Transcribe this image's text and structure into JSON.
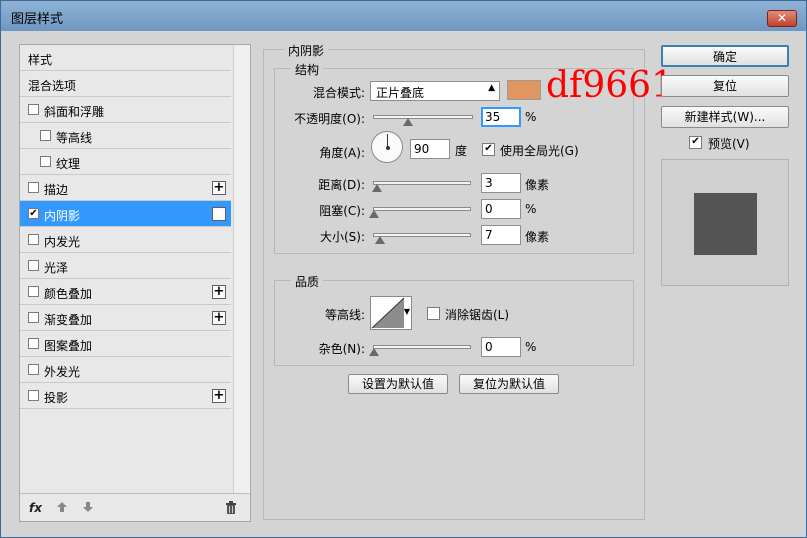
{
  "window": {
    "title": "图层样式",
    "close_label": "✕"
  },
  "style_list": {
    "items": [
      {
        "label": "样式",
        "checkbox": false,
        "plus": false,
        "indent": 0,
        "checked": false,
        "selected": false
      },
      {
        "label": "混合选项",
        "checkbox": false,
        "plus": false,
        "indent": 0,
        "checked": false,
        "selected": false
      },
      {
        "label": "斜面和浮雕",
        "checkbox": true,
        "plus": false,
        "indent": 0,
        "checked": false,
        "selected": false
      },
      {
        "label": "等高线",
        "checkbox": true,
        "plus": false,
        "indent": 1,
        "checked": false,
        "selected": false
      },
      {
        "label": "纹理",
        "checkbox": true,
        "plus": false,
        "indent": 1,
        "checked": false,
        "selected": false
      },
      {
        "label": "描边",
        "checkbox": true,
        "plus": true,
        "indent": 0,
        "checked": false,
        "selected": false
      },
      {
        "label": "内阴影",
        "checkbox": true,
        "plus": true,
        "indent": 0,
        "checked": true,
        "selected": true
      },
      {
        "label": "内发光",
        "checkbox": true,
        "plus": false,
        "indent": 0,
        "checked": false,
        "selected": false
      },
      {
        "label": "光泽",
        "checkbox": true,
        "plus": false,
        "indent": 0,
        "checked": false,
        "selected": false
      },
      {
        "label": "颜色叠加",
        "checkbox": true,
        "plus": true,
        "indent": 0,
        "checked": false,
        "selected": false
      },
      {
        "label": "渐变叠加",
        "checkbox": true,
        "plus": true,
        "indent": 0,
        "checked": false,
        "selected": false
      },
      {
        "label": "图案叠加",
        "checkbox": true,
        "plus": false,
        "indent": 0,
        "checked": false,
        "selected": false
      },
      {
        "label": "外发光",
        "checkbox": true,
        "plus": false,
        "indent": 0,
        "checked": false,
        "selected": false
      },
      {
        "label": "投影",
        "checkbox": true,
        "plus": true,
        "indent": 0,
        "checked": false,
        "selected": false
      }
    ],
    "footer": {
      "fx_label": "fx",
      "up_icon": "arrow-up-icon",
      "down_icon": "arrow-down-icon",
      "trash_icon": "trash-icon"
    }
  },
  "inner_shadow": {
    "title": "内阴影",
    "structure": {
      "title": "结构",
      "blend_mode_label": "混合模式:",
      "blend_mode_value": "正片叠底",
      "color_swatch": "#df9661",
      "annotation": "df9661",
      "opacity_label": "不透明度(O):",
      "opacity_value": "35",
      "opacity_level": 0.35,
      "percent": "%",
      "angle_label": "角度(A):",
      "angle_value": "90",
      "angle_unit": "度",
      "global_light_label": "使用全局光(G)",
      "global_light_checked": true,
      "distance_label": "距离(D):",
      "distance_value": "3",
      "pixels": "像素",
      "choke_label": "阻塞(C):",
      "choke_value": "0",
      "size_label": "大小(S):",
      "size_value": "7"
    },
    "quality": {
      "title": "品质",
      "contour_label": "等高线:",
      "antialias_label": "消除锯齿(L)",
      "antialias_checked": false,
      "noise_label": "杂色(N):",
      "noise_value": "0"
    },
    "make_default_label": "设置为默认值",
    "reset_default_label": "复位为默认值"
  },
  "actions": {
    "ok_label": "确定",
    "reset_label": "复位",
    "new_style_label": "新建样式(W)...",
    "preview_label": "预览(V)",
    "preview_checked": true,
    "preview_swatch": "#555555"
  }
}
